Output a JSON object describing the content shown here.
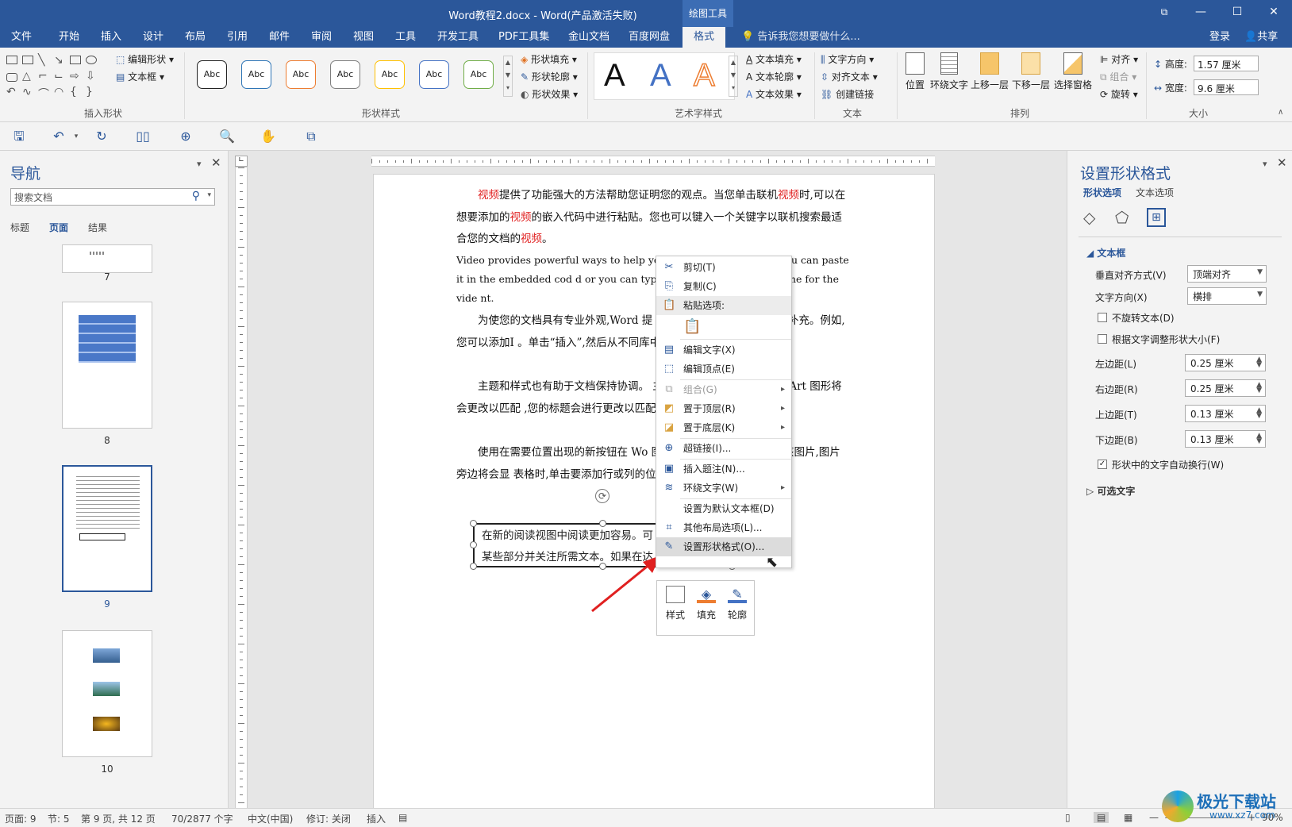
{
  "window": {
    "title": "Word教程2.docx - Word(产品激活失败)",
    "contextual_tab": "绘图工具",
    "controls": {
      "restore": "⧉",
      "minimize": "—",
      "maximize": "☐",
      "close": "✕"
    }
  },
  "tabs": [
    "文件",
    "开始",
    "插入",
    "设计",
    "布局",
    "引用",
    "邮件",
    "审阅",
    "视图",
    "工具",
    "开发工具",
    "PDF工具集",
    "金山文档",
    "百度网盘",
    "格式"
  ],
  "tell_me": "告诉我您想要做什么...",
  "account": {
    "login": "登录",
    "share": "共享"
  },
  "ribbon": {
    "insert_shapes": {
      "label": "插入形状",
      "edit_shape": "编辑形状",
      "text_box": "文本框"
    },
    "shape_styles": {
      "label": "形状样式",
      "sample": "Abc",
      "fill": "形状填充",
      "outline": "形状轮廓",
      "effect": "形状效果",
      "colors": [
        "#222222",
        "#2e75b6",
        "#ed7d31",
        "#7f7f7f",
        "#ffc000",
        "#4472c4",
        "#70ad47"
      ]
    },
    "wordart": {
      "label": "艺术字样式",
      "letter": "A",
      "fill": "文本填充",
      "outline": "文本轮廓",
      "effect": "文本效果"
    },
    "text": {
      "label": "文本",
      "direction": "文字方向",
      "align": "对齐文本",
      "link": "创建链接"
    },
    "arrange": {
      "label": "排列",
      "position": "位置",
      "wrap": "环绕文字",
      "forward": "上移一层",
      "backward": "下移一层",
      "pane": "选择窗格",
      "align": "对齐",
      "group": "组合",
      "rotate": "旋转"
    },
    "size": {
      "label": "大小",
      "height_label": "高度:",
      "height": "1.57 厘米",
      "width_label": "宽度:",
      "width": "9.6 厘米"
    }
  },
  "nav": {
    "title": "导航",
    "search_placeholder": "搜索文档",
    "tabs": [
      "标题",
      "页面",
      "结果"
    ],
    "pages": [
      "7",
      "8",
      "9",
      "10"
    ]
  },
  "document": {
    "p1": [
      [
        "视频",
        "r"
      ],
      [
        "提供了功能强大的方法帮助您证明您的观点。当您单击联机",
        ""
      ],
      [
        "视频",
        "r"
      ],
      [
        "时,可以在想要添加的",
        ""
      ],
      [
        "视频",
        "r"
      ],
      [
        "的嵌入代码中进行粘贴。您也可以键入一个关键字以联机搜索最适合您的文档的",
        ""
      ],
      [
        "视频",
        "r"
      ],
      [
        "。",
        ""
      ]
    ],
    "p2": "Video provides powerful ways to help you p                         ick an online video, you can paste it in the embedded cod                         d or you can type a keyword to search online for the vide                         nt.",
    "p3": "为使您的文档具有专业外观,Word 提                    文本框设计,这些设计可互为补充。例如,您可以添加I                   。单击“插入”,然后从不同库中选择所需元素。",
    "p4": "主题和样式也有助于文档保持协调。                    主题时,图片、图表或 SmartArt 图形将会更改以匹配                    ,您的标题会进行更改以匹配新的主题。",
    "p5": "使用在需要位置出现的新按钮在 Wo                     图片适应文档的方式,请单击该图片,图片旁边将会显                     表格时,单击要添加行或列的位置,然后单击加号。",
    "textbox_line1": "在新的阅读视图中阅读更加容易。可",
    "textbox_line2": "某些部分并关注所需文本。如果在达"
  },
  "context_menu": {
    "cut": "剪切(T)",
    "copy": "复制(C)",
    "paste_options": "粘贴选项:",
    "edit_text": "编辑文字(X)",
    "edit_points": "编辑顶点(E)",
    "group": "组合(G)",
    "bring_front": "置于顶层(R)",
    "send_back": "置于底层(K)",
    "hyperlink": "超链接(I)...",
    "caption": "插入题注(N)...",
    "wrap_text": "环绕文字(W)",
    "set_default": "设置为默认文本框(D)",
    "more_layout": "其他布局选项(L)...",
    "format_shape": "设置形状格式(O)..."
  },
  "mini_toolbar": {
    "style": "样式",
    "fill": "填充",
    "outline": "轮廓"
  },
  "format_pane": {
    "title": "设置形状格式",
    "tab_shape": "形状选项",
    "tab_text": "文本选项",
    "section": "文本框",
    "valign_label": "垂直对齐方式(V)",
    "valign": "顶端对齐",
    "direction_label": "文字方向(X)",
    "direction": "横排",
    "no_rotate": "不旋转文本(D)",
    "autofit": "根据文字调整形状大小(F)",
    "left_label": "左边距(L)",
    "left": "0.25 厘米",
    "right_label": "右边距(R)",
    "right": "0.25 厘米",
    "top_label": "上边距(T)",
    "top": "0.13 厘米",
    "bottom_label": "下边距(B)",
    "bottom": "0.13 厘米",
    "wrap_in_shape": "形状中的文字自动换行(W)",
    "alt_text": "可选文字"
  },
  "status": {
    "page": "页面: 9",
    "section": "节: 5",
    "pageof": "第 9 页, 共 12 页",
    "words": "70/2877 个字",
    "lang": "中文(中国)",
    "track": "修订: 关闭",
    "mode": "插入",
    "zoom": "90%"
  },
  "watermark": {
    "name": "极光下载站",
    "url": "www.xz7.com"
  }
}
